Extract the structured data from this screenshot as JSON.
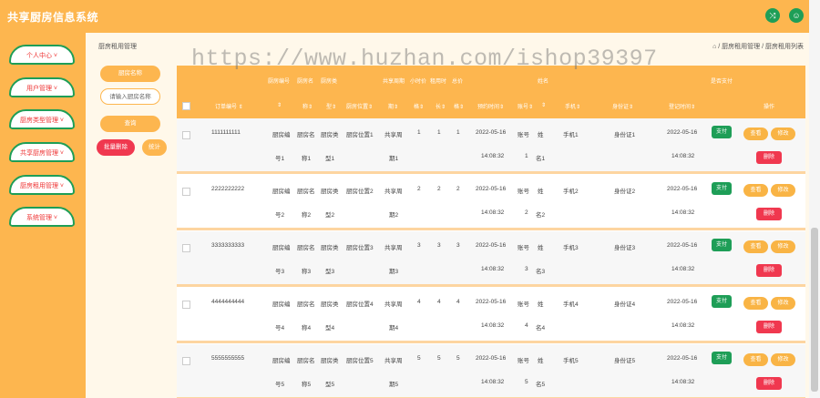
{
  "app": {
    "title": "共享厨房信息系统"
  },
  "topbar": {
    "icon1": "shuffle-icon",
    "icon2": "user-icon",
    "icon1_glyph": "⤨",
    "icon2_glyph": "☺"
  },
  "sidebar": {
    "items": [
      {
        "label": "个人中心 ˅"
      },
      {
        "label": "用户管理 ˅"
      },
      {
        "label": "厨房类型管理 ˅"
      },
      {
        "label": "共享厨房管理 ˅"
      },
      {
        "label": "厨房租用管理 ˅"
      },
      {
        "label": "系统管理 ˅"
      }
    ]
  },
  "breadcrumb": {
    "title": "厨房租用管理",
    "path": "⌂ / 厨房租用管理 / 厨房租用列表"
  },
  "search": {
    "label": "厨房名称",
    "placeholder": "请输入厨房名称",
    "query_btn": "查询",
    "batch_delete_btn": "批量删除",
    "stats_btn": "统计"
  },
  "watermark": "https://www.huzhan.com/ishop39397",
  "table": {
    "headers_top": {
      "kitchen_no": "厨房编号",
      "kitchen_name": "厨房名",
      "kitchen_type": "厨房类",
      "share_period": "共享周期",
      "hourly_price": "小时价",
      "rent_hours": "租用时",
      "total": "总价",
      "name": "姓名",
      "paid": "是否支付"
    },
    "headers_bottom": {
      "order_no": "订单编号 ⇕",
      "kitchen_no": "⇕",
      "kitchen_name": "称⇕",
      "kitchen_type": "型⇕",
      "location": "厨房位置⇕",
      "share_period": "期⇕",
      "hourly_price": "格⇕",
      "rent_hours": "长⇕",
      "total": "格⇕",
      "rent_time": "预约时间⇕",
      "account": "账号⇕",
      "name": "⇕",
      "phone": "手机⇕",
      "idcard": "身份证⇕",
      "reg_time": "登记时间⇕",
      "action": "操作"
    },
    "buttons": {
      "pay": "支付",
      "view": "查看",
      "edit": "修改",
      "delete": "删除"
    },
    "rows": [
      {
        "order": "1111111111",
        "kno": "厨房编",
        "kno2": "号1",
        "kname": "厨房名",
        "kname2": "称1",
        "ktype": "厨房类",
        "ktype2": "型1",
        "loc": "厨房位置1",
        "period": "共享周",
        "period2": "期1",
        "price": "1",
        "hours": "1",
        "total": "1",
        "date": "2022-05-16",
        "time": "14:08:32",
        "acct": "账号",
        "acct2": "1",
        "nm": "姓",
        "nm2": "名1",
        "phone": "手机1",
        "id": "身份证1",
        "rdate": "2022-05-16",
        "rtime": "14:08:32"
      },
      {
        "order": "2222222222",
        "kno": "厨房编",
        "kno2": "号2",
        "kname": "厨房名",
        "kname2": "称2",
        "ktype": "厨房类",
        "ktype2": "型2",
        "loc": "厨房位置2",
        "period": "共享周",
        "period2": "期2",
        "price": "2",
        "hours": "2",
        "total": "2",
        "date": "2022-05-16",
        "time": "14:08:32",
        "acct": "账号",
        "acct2": "2",
        "nm": "姓",
        "nm2": "名2",
        "phone": "手机2",
        "id": "身份证2",
        "rdate": "2022-05-16",
        "rtime": "14:08:32"
      },
      {
        "order": "3333333333",
        "kno": "厨房编",
        "kno2": "号3",
        "kname": "厨房名",
        "kname2": "称3",
        "ktype": "厨房类",
        "ktype2": "型3",
        "loc": "厨房位置3",
        "period": "共享周",
        "period2": "期3",
        "price": "3",
        "hours": "3",
        "total": "3",
        "date": "2022-05-16",
        "time": "14:08:32",
        "acct": "账号",
        "acct2": "3",
        "nm": "姓",
        "nm2": "名3",
        "phone": "手机3",
        "id": "身份证3",
        "rdate": "2022-05-16",
        "rtime": "14:08:32"
      },
      {
        "order": "4444444444",
        "kno": "厨房编",
        "kno2": "号4",
        "kname": "厨房名",
        "kname2": "称4",
        "ktype": "厨房类",
        "ktype2": "型4",
        "loc": "厨房位置4",
        "period": "共享周",
        "period2": "期4",
        "price": "4",
        "hours": "4",
        "total": "4",
        "date": "2022-05-16",
        "time": "14:08:32",
        "acct": "账号",
        "acct2": "4",
        "nm": "姓",
        "nm2": "名4",
        "phone": "手机4",
        "id": "身份证4",
        "rdate": "2022-05-16",
        "rtime": "14:08:32"
      },
      {
        "order": "5555555555",
        "kno": "厨房编",
        "kno2": "号5",
        "kname": "厨房名",
        "kname2": "称5",
        "ktype": "厨房类",
        "ktype2": "型5",
        "loc": "厨房位置5",
        "period": "共享周",
        "period2": "期5",
        "price": "5",
        "hours": "5",
        "total": "5",
        "date": "2022-05-16",
        "time": "14:08:32",
        "acct": "账号",
        "acct2": "5",
        "nm": "姓",
        "nm2": "名5",
        "phone": "手机5",
        "id": "身份证5",
        "rdate": "2022-05-16",
        "rtime": "14:08:32"
      }
    ]
  }
}
